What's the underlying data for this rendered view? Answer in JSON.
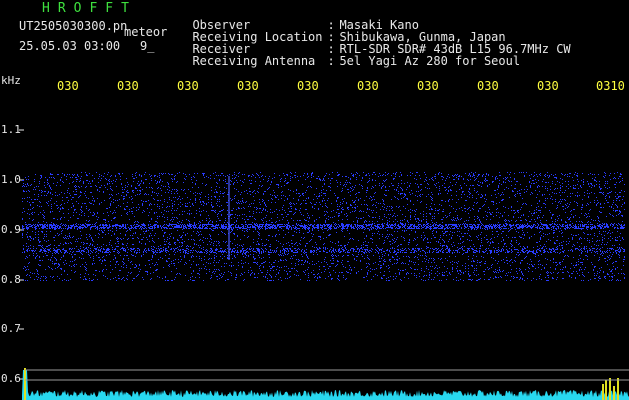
{
  "header": {
    "app_title": "HROFFT",
    "filename": "UT2505030300.pn",
    "meteor_label": "meteor",
    "datetime": "25.05.03 03:00",
    "count": "9_"
  },
  "info": [
    {
      "label": "Observer",
      "value": "Masaki Kano"
    },
    {
      "label": "Receiving Location",
      "value": "Shibukawa, Gunma, Japan"
    },
    {
      "label": "Receiver",
      "value": "RTL-SDR SDR# 43dB L15 96.7MHz CW"
    },
    {
      "label": "Receiving Antenna",
      "value": "5el Yagi Az 280 for Seoul"
    }
  ],
  "spectrogram": {
    "unit_label": "kHz",
    "y_ticks": [
      "1.1",
      "1.0",
      "0.9",
      "0.8",
      "0.7",
      "0.6"
    ],
    "x_ticks": [
      "030",
      "030",
      "030",
      "030",
      "030",
      "030",
      "030",
      "030",
      "030",
      "0310"
    ],
    "colors": {
      "background": "#000000",
      "noise": "#2a3cff",
      "ticks_x": "#ffff40",
      "ticks_y": "#e8e8e8",
      "amplitude": "#28d8f0",
      "peak": "#e0e020"
    }
  }
}
